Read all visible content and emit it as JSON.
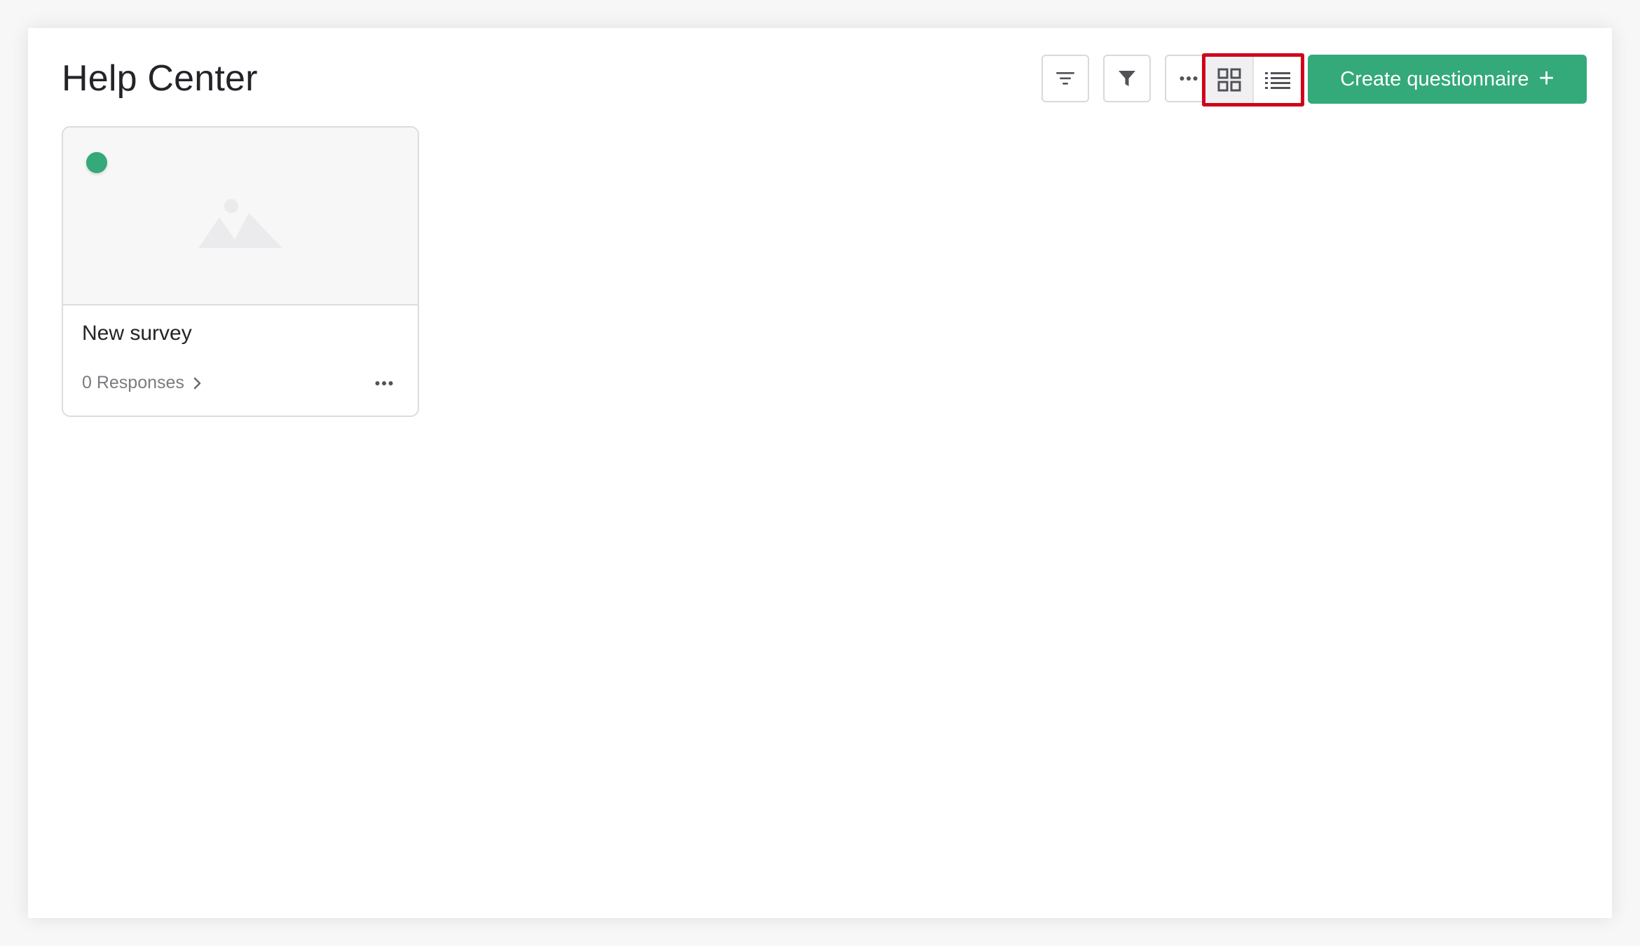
{
  "header": {
    "title": "Help Center",
    "toolbar": {
      "sort_icon": "sort-lines-icon",
      "filter_icon": "funnel-icon",
      "more_icon": "ellipsis-icon",
      "grid_view_icon": "grid-view-icon",
      "list_view_icon": "list-view-icon",
      "active_view": "grid"
    },
    "create_button": {
      "label": "Create questionnaire",
      "icon": "plus-icon"
    }
  },
  "surveys": [
    {
      "title": "New survey",
      "responses_label": "0 Responses",
      "status": "active",
      "thumbnail_icon": "image-placeholder-icon"
    }
  ],
  "colors": {
    "accent": "#34a97a",
    "highlight": "#d0021b",
    "text_primary": "#222428",
    "text_secondary": "#7a7b80"
  }
}
